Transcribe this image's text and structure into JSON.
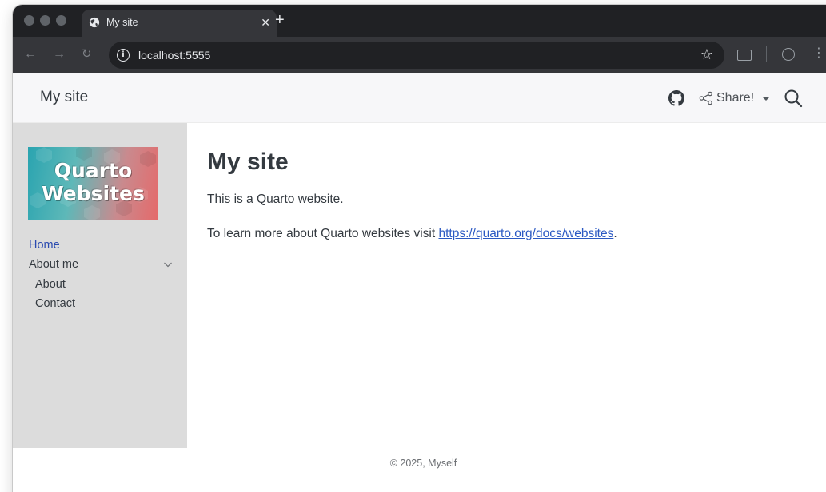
{
  "browser": {
    "tab": {
      "title": "My site",
      "favicon": "globe-icon",
      "close_icon": "close-icon"
    },
    "new_tab_icon": "plus-icon",
    "toolbar": {
      "back_icon": "back-arrow-icon",
      "forward_icon": "forward-arrow-icon",
      "reload_icon": "reload-icon",
      "site_info_icon": "info-icon",
      "url": "localhost:5555",
      "bookmark_icon": "star-icon",
      "profile_icon": "profile-icon",
      "menu_icon": "kebab-menu-icon"
    },
    "colors": {
      "frame": "#202124",
      "toolbar": "#35363a",
      "omnibox": "#202124"
    }
  },
  "site": {
    "navbar": {
      "brand": "My site",
      "github_icon": "github-icon",
      "share": {
        "label": "Share!",
        "icon": "share-icon",
        "caret_icon": "caret-down-icon"
      },
      "search_icon": "search-icon"
    },
    "sidebar": {
      "logo": {
        "line1": "Quarto",
        "line2": "Websites"
      },
      "items": [
        {
          "label": "Home",
          "active": true
        },
        {
          "label": "About me",
          "section": true,
          "expanded": true
        },
        {
          "label": "About",
          "indent": 1
        },
        {
          "label": "Contact",
          "indent": 1
        }
      ]
    },
    "main": {
      "title": "My site",
      "paragraph1": "This is a Quarto website.",
      "paragraph2_prefix": "To learn more about Quarto websites visit ",
      "paragraph2_link": "https://quarto.org/docs/websites",
      "paragraph2_suffix": "."
    },
    "footer": {
      "text": "© 2025, Myself"
    },
    "colors": {
      "navbar_bg": "#f7f7f9",
      "sidebar_bg": "#dcdcdc",
      "text": "#343a40",
      "link": "#2b59c3",
      "active_nav": "#2b4bb0"
    }
  }
}
